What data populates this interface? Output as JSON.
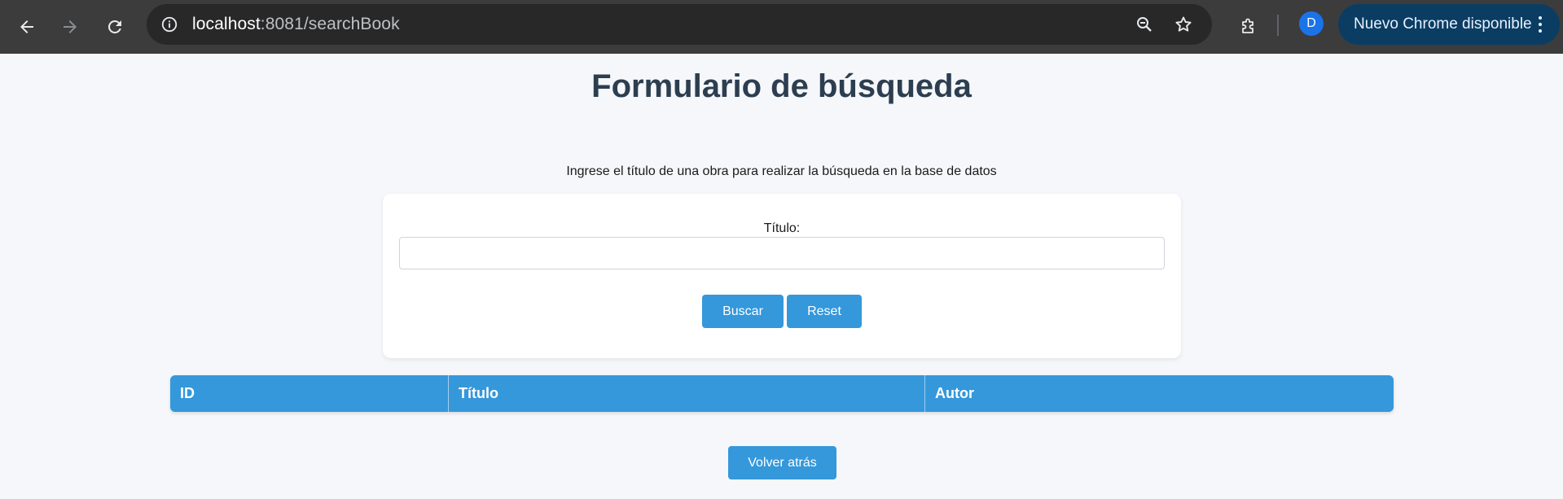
{
  "browser": {
    "url_host": "localhost",
    "url_rest": ":8081/searchBook",
    "profile_initial": "D",
    "update_label": "Nuevo Chrome disponible"
  },
  "page": {
    "title": "Formulario de búsqueda",
    "intro": "Ingrese el título de una obra para realizar la búsqueda en la base de datos"
  },
  "form": {
    "title_label": "Título:",
    "title_value": "",
    "search_button": "Buscar",
    "reset_button": "Reset"
  },
  "table": {
    "columns": [
      "ID",
      "Título",
      "Autor"
    ],
    "rows": []
  },
  "footer": {
    "back_button": "Volver atrás"
  },
  "colors": {
    "accent": "#3498db",
    "title": "#2c3e50",
    "background": "#f5f7fa"
  }
}
